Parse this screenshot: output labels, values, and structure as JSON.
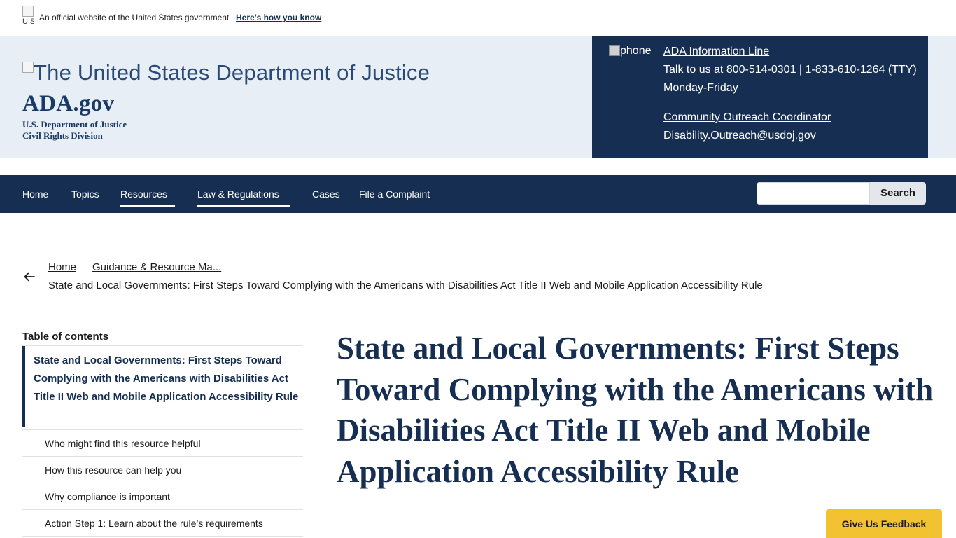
{
  "gov_banner": {
    "flag_alt": "U.S. flag",
    "text": "An official website of the United States government",
    "link": "Here’s how you know"
  },
  "header": {
    "doj_logo_alt": "The United States Department of Justice",
    "site_title": "ADA.gov",
    "subtitle_line1": "U.S. Department of Justice",
    "subtitle_line2": "Civil Rights Division"
  },
  "contact": {
    "phone_alt": "phone",
    "info_line_label": "ADA Information Line",
    "info_line_text": "Talk to us at 800-514-0301 | 1-833-610-1264 (TTY)",
    "info_line_hours": "Monday-Friday",
    "outreach_label": "Community Outreach Coordinator",
    "outreach_email": "Disability.Outreach@usdoj.gov"
  },
  "nav": {
    "items": [
      {
        "label": "Home"
      },
      {
        "label": "Topics"
      },
      {
        "label": "Resources"
      },
      {
        "label": "Law & Regulations"
      },
      {
        "label": "Cases"
      },
      {
        "label": "File a Complaint"
      }
    ],
    "search_placeholder": "",
    "search_button": "Search"
  },
  "breadcrumb": {
    "items": [
      {
        "label": "Home"
      },
      {
        "label": "Guidance & Resource Ma..."
      }
    ],
    "current": "State and Local Governments: First Steps Toward Complying with the Americans with Disabilities Act Title II Web and Mobile Application Accessibility Rule"
  },
  "toc": {
    "title": "Table of contents",
    "current": "State and Local Governments: First Steps Toward Complying with the Americans with Disabilities Act Title II Web and Mobile Application Accessibility Rule",
    "items": [
      {
        "label": "Who might find this resource helpful"
      },
      {
        "label": "How this resource can help you"
      },
      {
        "label": "Why compliance is important"
      },
      {
        "label": "Action Step 1: Learn about the rule’s requirements"
      }
    ]
  },
  "main": {
    "title": "State and Local Governments: First Steps Toward Complying with the Americans with Disabilities Act Title II Web and Mobile Application Accessibility Rule"
  },
  "feedback": {
    "label": "Give Us Feedback"
  },
  "colors": {
    "navy": "#162e51",
    "header_bg": "#e8eef6",
    "feedback_yellow": "#f2c230"
  }
}
